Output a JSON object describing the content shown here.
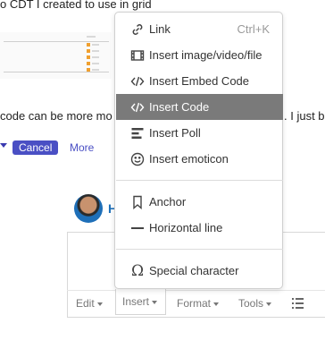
{
  "post": {
    "line1": "o CDT I created to use in grid",
    "line2": "code can be more mo",
    "line2_tail": ". I just b"
  },
  "actions": {
    "cancel": "Cancel",
    "more": "More"
  },
  "author": {
    "initial": "H"
  },
  "toolbar": {
    "edit": "Edit",
    "insert": "Insert",
    "format": "Format",
    "tools": "Tools"
  },
  "menu": {
    "items": [
      {
        "label": "Link",
        "shortcut": "Ctrl+K",
        "icon": "link-icon"
      },
      {
        "label": "Insert image/video/file",
        "icon": "media-icon"
      },
      {
        "label": "Insert Embed Code",
        "icon": "embed-code-icon"
      },
      {
        "label": "Insert Code",
        "icon": "code-icon",
        "active": true
      },
      {
        "label": "Insert Poll",
        "icon": "poll-icon"
      },
      {
        "label": "Insert emoticon",
        "icon": "emoticon-icon"
      },
      {
        "label": "Anchor",
        "icon": "bookmark-icon"
      },
      {
        "label": "Horizontal line",
        "icon": "horizontal-line-icon"
      },
      {
        "label": "Special character",
        "icon": "omega-icon"
      }
    ]
  },
  "colors": {
    "highlight": "#7a7a7a",
    "accent": "#4a4fc4",
    "link": "#1e6fb8"
  }
}
